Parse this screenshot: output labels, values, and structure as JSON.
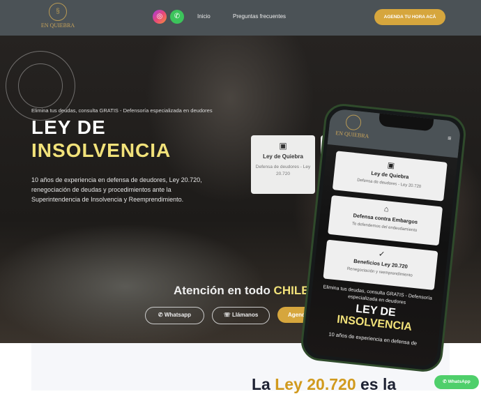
{
  "header": {
    "logo": "EN QUIEBRA",
    "nav": [
      "Inicio",
      "Preguntas frecuentes"
    ],
    "cta": "AGENDA TU HORA ACÁ"
  },
  "hero": {
    "subtitle": "Elimina tus deudas, consulta GRATIS - Defensoría especializada en deudores",
    "title_line1": "LEY DE",
    "title_line2": "INSOLVENCIA",
    "description": "10 años de experiencia en defensa de deudores, Ley 20.720, renegociación de deudas y procedimientos ante la Superintendencia de Insolvencia y Reemprendimiento.",
    "card": {
      "title": "Ley de Quiebra",
      "desc": "Defensa de deudores - Ley 20.720"
    },
    "attention": "Atención en todo ",
    "attention_highlight": "CHILE",
    "buttons": {
      "whatsapp": "Whatsapp",
      "call": "Llámanos",
      "agenda": "Agenda"
    }
  },
  "phone": {
    "logo": "EN QUIEBRA",
    "cards": [
      {
        "title": "Ley de Quiebra",
        "desc": "Defensa de deudores - Ley 20.720"
      },
      {
        "title": "Defensa contra Embargos",
        "desc": "Te defendemos del endeudamiento"
      },
      {
        "title": "Beneficios Ley 20.720",
        "desc": "Renegociación y reemprendimiento"
      }
    ],
    "subtitle": "Elimina tus deudas, consulta GRATIS - Defensoría especializada en deudores",
    "title_line1": "LEY DE",
    "title_line2": "INSOLVENCIA",
    "description": "10 años de experiencia en defensa de"
  },
  "section": {
    "heading_pre": "La ",
    "heading_highlight": "Ley 20.720",
    "heading_post": " es la"
  },
  "float_whatsapp": "WhatsApp"
}
